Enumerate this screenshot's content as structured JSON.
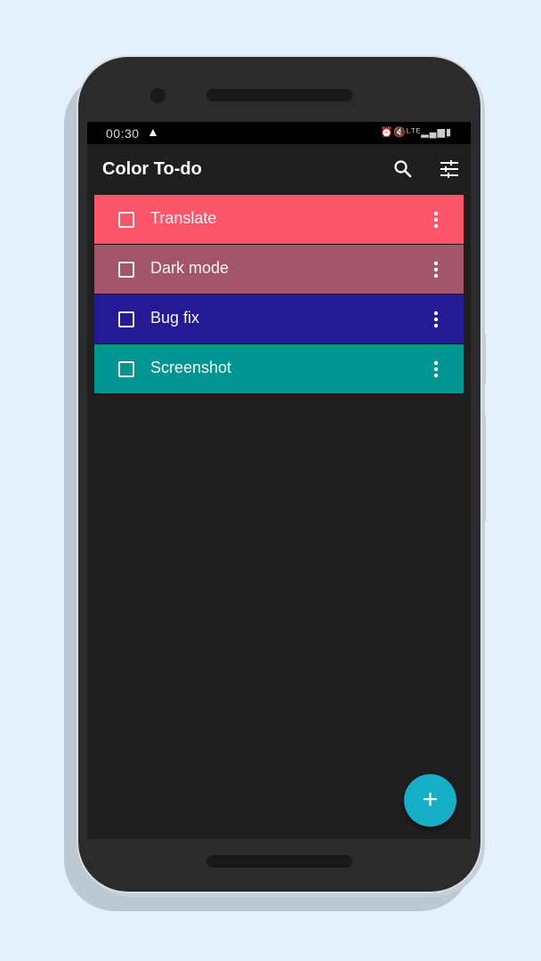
{
  "status_bar": {
    "time": "00:30",
    "warning_icon": "warning-icon",
    "right_icons": [
      "alarm-icon",
      "mute-icon",
      "lte-icon",
      "signal-icon",
      "battery-icon"
    ]
  },
  "app_bar": {
    "title": "Color To-do",
    "actions": [
      {
        "icon": "search-icon",
        "label": "Search"
      },
      {
        "icon": "tune-icon",
        "label": "Filter"
      }
    ]
  },
  "todos": [
    {
      "label": "Translate",
      "color": "#fd556a",
      "checked": false
    },
    {
      "label": "Dark mode",
      "color": "#a2556b",
      "checked": false
    },
    {
      "label": "Bug fix",
      "color": "#241a93",
      "checked": false
    },
    {
      "label": "Screenshot",
      "color": "#009591",
      "checked": false
    }
  ],
  "fab": {
    "icon": "plus-icon",
    "label": "+",
    "color": "#15b0c8"
  }
}
